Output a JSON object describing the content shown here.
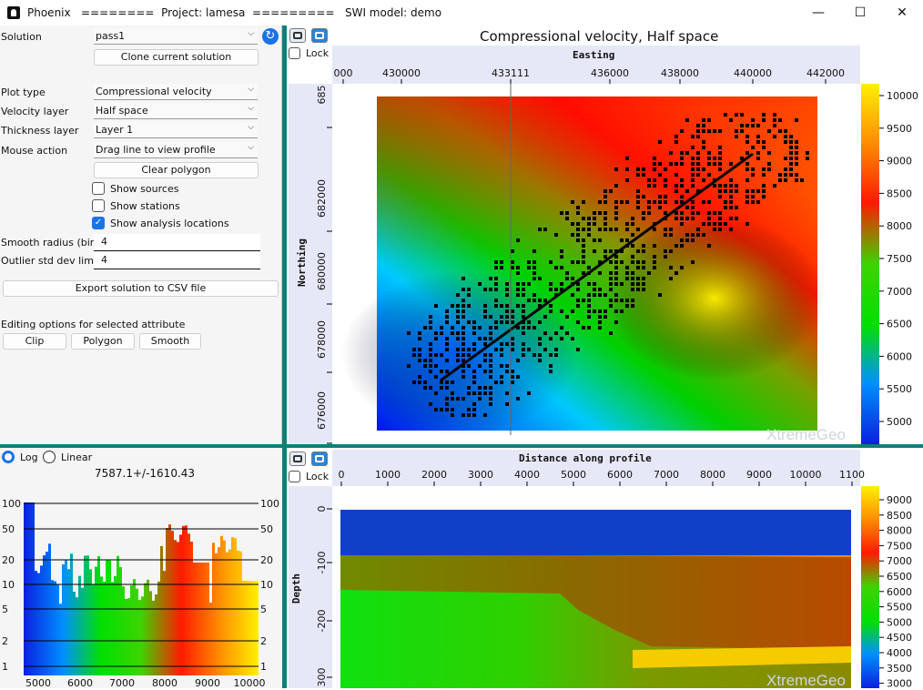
{
  "window": {
    "title": "Phoenix   ========  Project: lamesa  =========   SWI model: demo",
    "minimize": "—",
    "maximize": "☐",
    "close": "✕"
  },
  "controls": {
    "solution_label": "Solution",
    "solution_value": "pass1",
    "clone_button": "Clone current solution",
    "plot_type_label": "Plot type",
    "plot_type_value": "Compressional velocity",
    "velocity_layer_label": "Velocity layer",
    "velocity_layer_value": "Half space",
    "thickness_layer_label": "Thickness layer",
    "thickness_layer_value": "Layer 1",
    "mouse_action_label": "Mouse action",
    "mouse_action_value": "Drag line to view profile",
    "clear_polygon_button": "Clear polygon",
    "show_sources": "Show sources",
    "show_stations": "Show stations",
    "show_analysis": "Show analysis locations",
    "show_sources_checked": false,
    "show_stations_checked": false,
    "show_analysis_checked": true,
    "smooth_radius_label": "Smooth radius (bins)",
    "smooth_radius_value": "4",
    "outlier_label": "Outlier std dev limit",
    "outlier_value": "4",
    "export_button": "Export solution to CSV file",
    "editing_label": "Editing options for selected attribute",
    "clip_button": "Clip",
    "polygon_button": "Polygon",
    "smooth_button": "Smooth"
  },
  "histogram": {
    "log_label": "Log",
    "linear_label": "Linear",
    "selected": "Log",
    "stats": "7587.1+/-1610.43",
    "y_ticks": [
      "100",
      "50",
      "20",
      "10",
      "5",
      "2",
      "1"
    ],
    "x_ticks": [
      "5000",
      "6000",
      "7000",
      "8000",
      "9000",
      "10000"
    ]
  },
  "map": {
    "title": "Compressional velocity, Half space",
    "lock_label": "Lock",
    "x_axis_title": "Easting",
    "y_axis_title": "Northing",
    "x_ticks": [
      "000",
      "430000",
      "433111",
      "436000",
      "438000",
      "440000",
      "442000"
    ],
    "y_ticks": [
      "685",
      "682000",
      "680000",
      "678000",
      "676000"
    ],
    "colorbar_ticks": [
      "10000",
      "9500",
      "9000",
      "8500",
      "8000",
      "7500",
      "7000",
      "6500",
      "6000",
      "5500",
      "5000"
    ],
    "watermark": "XtremeGeo"
  },
  "profile": {
    "lock_label": "Lock",
    "x_axis_title": "Distance along profile",
    "y_axis_title": "Depth",
    "x_ticks": [
      "0",
      "1000",
      "2000",
      "3000",
      "4000",
      "5000",
      "6000",
      "7000",
      "8000",
      "9000",
      "10000",
      "1100"
    ],
    "y_ticks": [
      "0",
      "-100",
      "-200",
      "300"
    ],
    "colorbar_ticks": [
      "9000",
      "8500",
      "8000",
      "7500",
      "7000",
      "6500",
      "6000",
      "5500",
      "5000",
      "4500",
      "4000",
      "3500",
      "3000"
    ],
    "watermark": "XtremeGeo"
  },
  "colors": {
    "accent": "#1a73e8",
    "splitter": "#0e8077"
  }
}
